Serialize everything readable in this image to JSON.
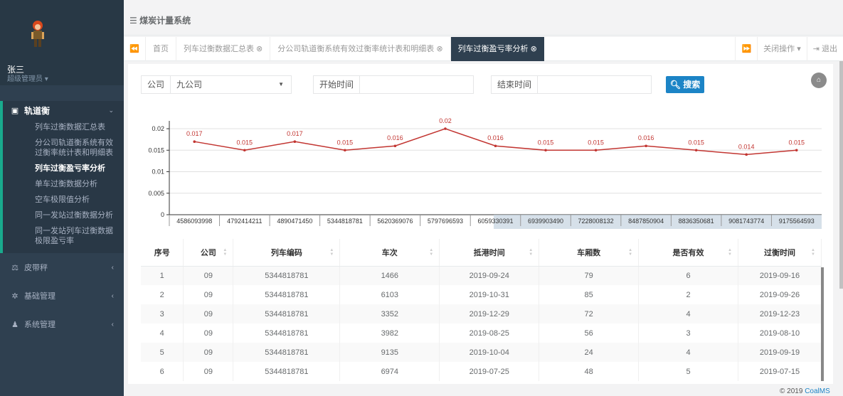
{
  "app": {
    "title": "煤炭计量系统",
    "copyright": "© 2019",
    "copyright_brand": "CoalMS"
  },
  "user": {
    "name": "张三",
    "role": "超级管理员 ▾"
  },
  "sidebar": {
    "active_group": "轨道衡",
    "sub_items": [
      "列车过衡数据汇总表",
      "分公司轨道衡系统有效过衡率统计表和明细表",
      "列车过衡盈亏率分析",
      "单车过衡数据分析",
      "空车极限值分析",
      "同一发站过衡数据分析",
      "同一发站列车过衡数据极限盈亏率"
    ],
    "current_index": 2,
    "groups": [
      "皮带秤",
      "基础管理",
      "系统管理"
    ]
  },
  "tabs": {
    "items": [
      "首页",
      "列车过衡数据汇总表 ⊗",
      "分公司轨道衡系统有效过衡率统计表和明细表 ⊗"
    ],
    "active": "列车过衡盈亏率分析 ⊗",
    "close_ops": "关闭操作 ▾",
    "logout": "⇥ 退出"
  },
  "filter": {
    "company_label": "公司",
    "company_value": "九公司",
    "start_label": "开始时间",
    "end_label": "结束时间",
    "search_button": "搜索"
  },
  "chart_data": {
    "type": "line",
    "categories": [
      "4586093998",
      "4792414211",
      "4890471450",
      "5344818781",
      "5620369076",
      "5797696593",
      "6059330391",
      "6939903490",
      "7228008132",
      "8487850904",
      "8836350681",
      "9081743774",
      "9175564593"
    ],
    "series": [
      {
        "values": [
          0.017,
          0.015,
          0.017,
          0.015,
          0.016,
          0.02,
          0.016,
          0.015,
          0.015,
          0.016,
          0.015,
          0.014,
          0.015
        ],
        "color": "#c23531"
      }
    ],
    "y_ticks": [
      "0",
      "0.005",
      "0.01",
      "0.015",
      "0.02"
    ],
    "ylim": [
      0,
      0.021
    ],
    "grid": true
  },
  "table": {
    "headers": [
      "序号",
      "公司",
      "列车编码",
      "车次",
      "抵港时间",
      "车厢数",
      "是否有效",
      "过衡时间"
    ],
    "rows": [
      [
        "1",
        "09",
        "5344818781",
        "1466",
        "2019-09-24",
        "79",
        "6",
        "2019-09-16"
      ],
      [
        "2",
        "09",
        "5344818781",
        "6103",
        "2019-10-31",
        "85",
        "2",
        "2019-09-26"
      ],
      [
        "3",
        "09",
        "5344818781",
        "3352",
        "2019-12-29",
        "72",
        "4",
        "2019-12-23"
      ],
      [
        "4",
        "09",
        "5344818781",
        "3982",
        "2019-08-25",
        "56",
        "3",
        "2019-08-10"
      ],
      [
        "5",
        "09",
        "5344818781",
        "9135",
        "2019-10-04",
        "24",
        "4",
        "2019-09-19"
      ],
      [
        "6",
        "09",
        "5344818781",
        "6974",
        "2019-07-25",
        "48",
        "5",
        "2019-07-15"
      ]
    ]
  }
}
